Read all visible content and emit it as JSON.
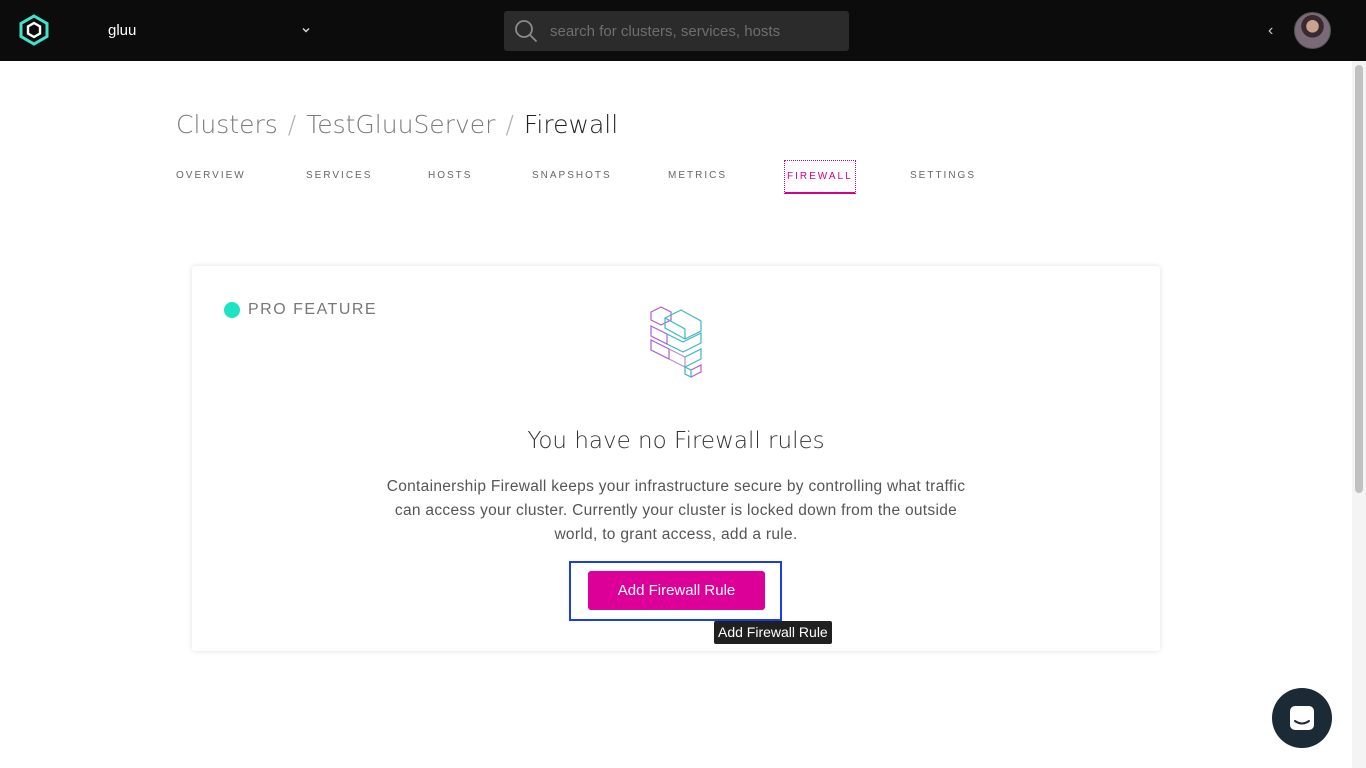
{
  "topbar": {
    "org_name": "gluu",
    "search_placeholder": "search for clusters, services, hosts",
    "collapse_glyph": "‹"
  },
  "breadcrumb": {
    "clusters": "Clusters",
    "cluster_name": "TestGluuServer",
    "current": "Firewall"
  },
  "tabs": [
    "OVERVIEW",
    "SERVICES",
    "HOSTS",
    "SNAPSHOTS",
    "METRICS",
    "FIREWALL",
    "SETTINGS"
  ],
  "active_tab": "FIREWALL",
  "card": {
    "badge": "PRO FEATURE",
    "title": "You have no Firewall rules",
    "description": "Containership Firewall keeps your infrastructure secure by controlling what traffic can access your cluster. Currently your cluster is locked down from the outside world, to grant access, add a rule.",
    "button_label": "Add Firewall Rule",
    "tooltip": "Add Firewall Rule"
  },
  "colors": {
    "accent": "#dd0098",
    "pro_dot": "#1ee2c4",
    "topbar": "#0c0c0c"
  },
  "icons": [
    "containership-logo-icon",
    "chevron-down-icon",
    "search-icon",
    "chevron-left-icon",
    "firewall-bricks-icon",
    "chat-icon"
  ]
}
